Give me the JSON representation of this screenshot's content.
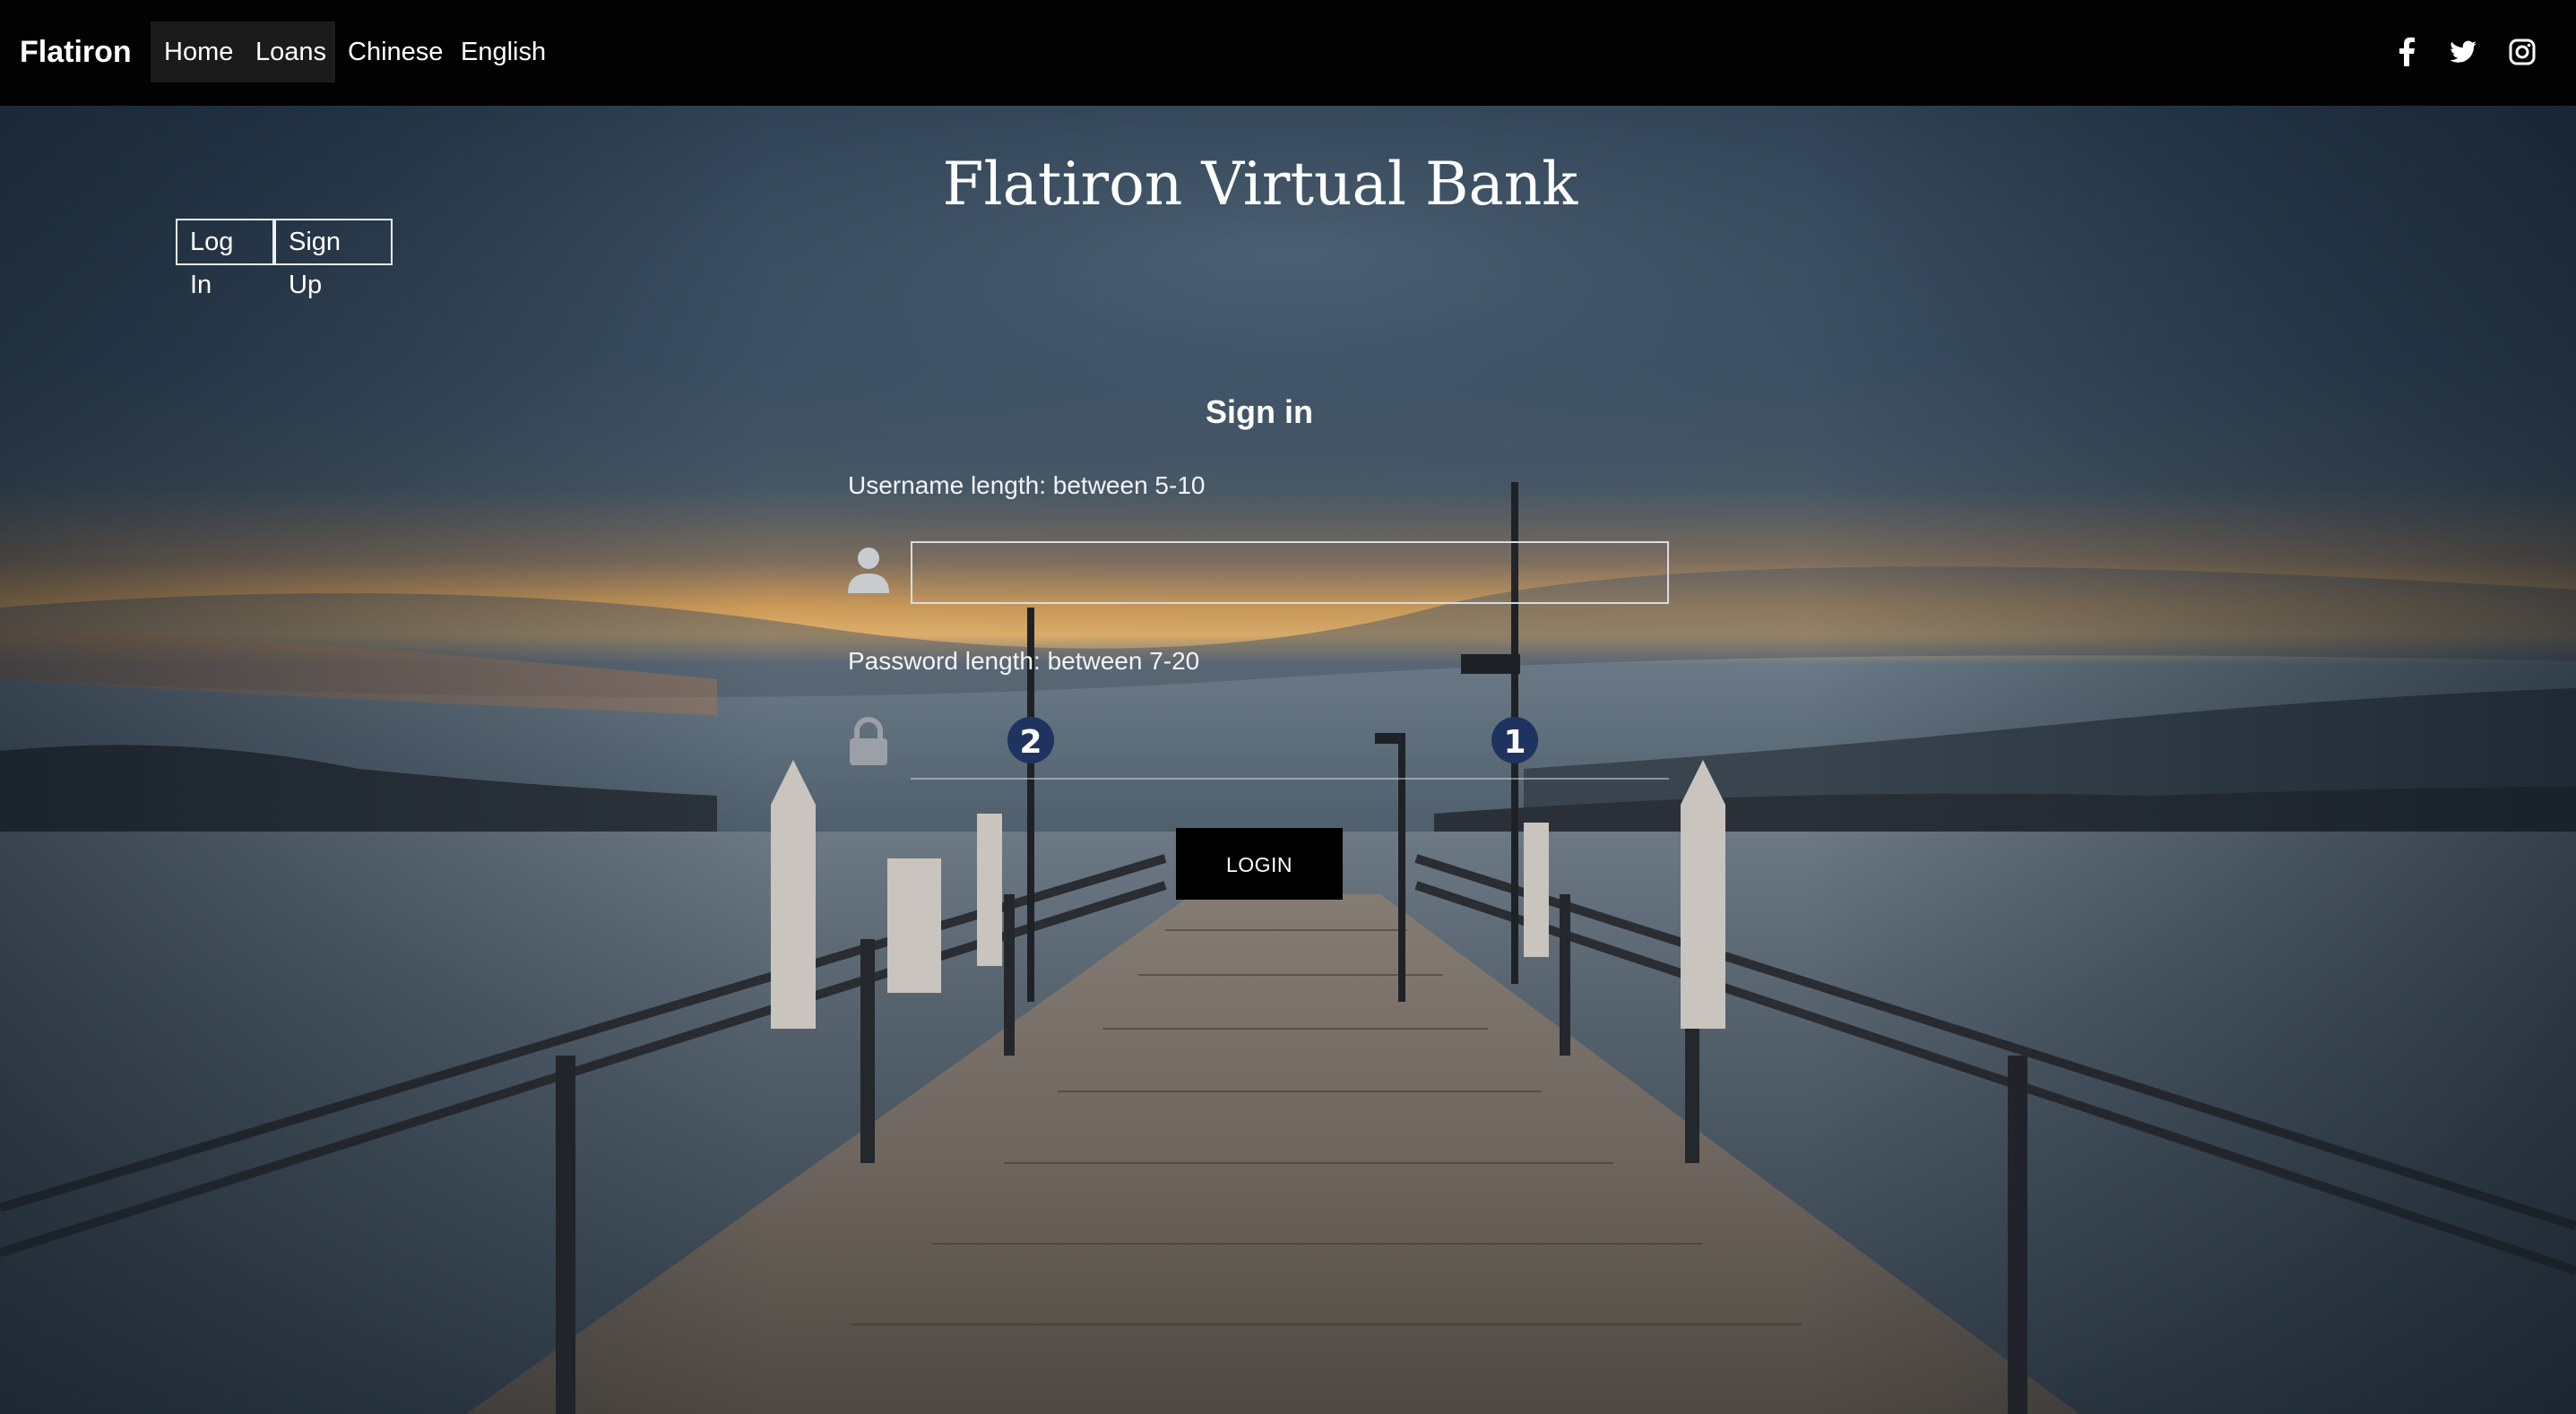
{
  "navbar": {
    "brand": "Flatiron",
    "links": [
      {
        "label": "Home"
      },
      {
        "label": "Loans"
      },
      {
        "label": "Chinese"
      },
      {
        "label": "English"
      }
    ],
    "social_icons": [
      "facebook-icon",
      "twitter-icon",
      "instagram-icon"
    ]
  },
  "header": {
    "title": "Flatiron Virtual Bank"
  },
  "auth_toggle": {
    "login_label": "Log In",
    "signup_label": "Sign Up"
  },
  "signin": {
    "title": "Sign in",
    "username_hint": "Username length: between 5-10",
    "username_value": "",
    "password_hint": "Password length: between 7-20",
    "password_value": "",
    "submit_label": "LOGIN"
  },
  "colors": {
    "navbar_bg": "#020202",
    "active_nav_bg": "#1b1b1b",
    "button_bg": "#000000",
    "text": "#ffffff"
  }
}
